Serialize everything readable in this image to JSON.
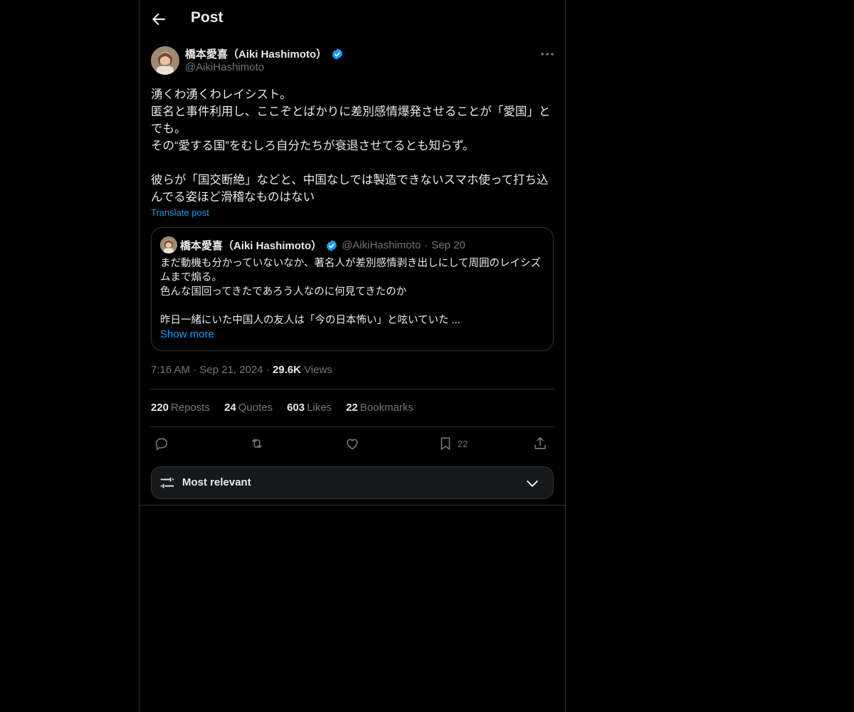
{
  "header": {
    "title": "Post"
  },
  "post": {
    "author_name": "橋本愛喜（Aiki Hashimoto）",
    "handle": "@AikiHashimoto",
    "text": "湧くわ湧くわレイシスト。\n匿名と事件利用し、ここぞとばかりに差別感情爆発させることが「愛国」とでも。\nその“愛する国”をむしろ自分たちが衰退させてるとも知らず。\n\n彼らが「国交断絶」などと、中国なしでは製造できないスマホ使って打ち込んでる姿ほど滑稽なものはない",
    "translate_label": "Translate post",
    "time": "7:16 AM",
    "date": "Sep 21, 2024",
    "views_count": "29.6K",
    "views_label": "Views"
  },
  "quote": {
    "author_name": "橋本愛喜（Aiki Hashimoto）",
    "handle": "@AikiHashimoto",
    "date": "Sep 20",
    "text": "まだ動機も分かっていないなか、著名人が差別感情剥き出しにして周囲のレイシズムまで煽る。\n色んな国回ってきたであろう人なのに何見てきたのか\n\n昨日一緒にいた中国人の友人は「今の日本怖い」と呟いていた ...",
    "show_more": "Show more"
  },
  "stats": {
    "reposts_count": "220",
    "reposts_label": "Reposts",
    "quotes_count": "24",
    "quotes_label": "Quotes",
    "likes_count": "603",
    "likes_label": "Likes",
    "bookmarks_count": "22",
    "bookmarks_label": "Bookmarks"
  },
  "actions": {
    "bookmark_count": "22"
  },
  "sort": {
    "label": "Most relevant"
  },
  "icons": {
    "back": "arrow-left-icon",
    "verified": "verified-badge-icon",
    "more": "more-horizontal-icon",
    "reply": "reply-icon",
    "repost": "repost-icon",
    "like": "heart-icon",
    "bookmark": "bookmark-icon",
    "share": "share-icon",
    "sort": "sliders-icon",
    "chevron": "chevron-down-icon"
  },
  "colors": {
    "background": "#000000",
    "accent": "#1d9bf0",
    "text": "#e7e9ea",
    "secondary": "#71767b",
    "border": "#2f3336"
  }
}
